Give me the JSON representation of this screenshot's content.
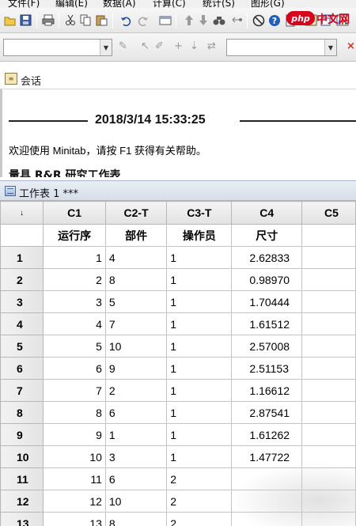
{
  "menu": {
    "items": [
      "文件(F)",
      "编辑(E)",
      "数据(A)",
      "计算(C)",
      "统计(S)",
      "图形(G)"
    ]
  },
  "logo": {
    "badge": "php",
    "text": "中文网"
  },
  "icons": {
    "toolbar1": [
      "open-icon",
      "save-icon",
      "print-icon",
      "cut-icon",
      "copy-icon",
      "paste-icon",
      "undo-icon",
      "redo-icon",
      "window-icon",
      "up-arrow-icon",
      "down-arrow-icon",
      "find-icon",
      "link-icon",
      "stop-icon",
      "help-icon",
      "info-icon",
      "session-icon",
      "worksheets-icon",
      "graph-icon"
    ],
    "toolbar2": [
      "brush-icon",
      "pointer-icon",
      "pen-icon",
      "plus-icon",
      "arrow-icon",
      "swap-icon"
    ]
  },
  "session": {
    "title": "会话",
    "timestamp": "2018/3/14 15:33:25",
    "welcome": "欢迎使用 Minitab，请按 F1 获得有关帮助。",
    "cut_heading": "量具 R&R 研究工作表"
  },
  "worksheet": {
    "title": "工作表 1 ***",
    "corner": "↓",
    "columns": [
      "C1",
      "C2-T",
      "C3-T",
      "C4",
      "C5"
    ],
    "names": [
      "运行序",
      "部件",
      "操作员",
      "尺寸",
      ""
    ],
    "rows": [
      {
        "n": "1",
        "c1": "1",
        "c2": "4",
        "c3": "1",
        "c4": "2.62833"
      },
      {
        "n": "2",
        "c1": "2",
        "c2": "8",
        "c3": "1",
        "c4": "0.98970"
      },
      {
        "n": "3",
        "c1": "3",
        "c2": "5",
        "c3": "1",
        "c4": "1.70444"
      },
      {
        "n": "4",
        "c1": "4",
        "c2": "7",
        "c3": "1",
        "c4": "1.61512"
      },
      {
        "n": "5",
        "c1": "5",
        "c2": "10",
        "c3": "1",
        "c4": "2.57008"
      },
      {
        "n": "6",
        "c1": "6",
        "c2": "9",
        "c3": "1",
        "c4": "2.51153"
      },
      {
        "n": "7",
        "c1": "7",
        "c2": "2",
        "c3": "1",
        "c4": "1.16612"
      },
      {
        "n": "8",
        "c1": "8",
        "c2": "6",
        "c3": "1",
        "c4": "2.87541"
      },
      {
        "n": "9",
        "c1": "9",
        "c2": "1",
        "c3": "1",
        "c4": "1.61262"
      },
      {
        "n": "10",
        "c1": "10",
        "c2": "3",
        "c3": "1",
        "c4": "1.47722"
      },
      {
        "n": "11",
        "c1": "11",
        "c2": "6",
        "c3": "2",
        "c4": ""
      },
      {
        "n": "12",
        "c1": "12",
        "c2": "10",
        "c3": "2",
        "c4": ""
      },
      {
        "n": "13",
        "c1": "13",
        "c2": "8",
        "c3": "2",
        "c4": ""
      }
    ]
  }
}
